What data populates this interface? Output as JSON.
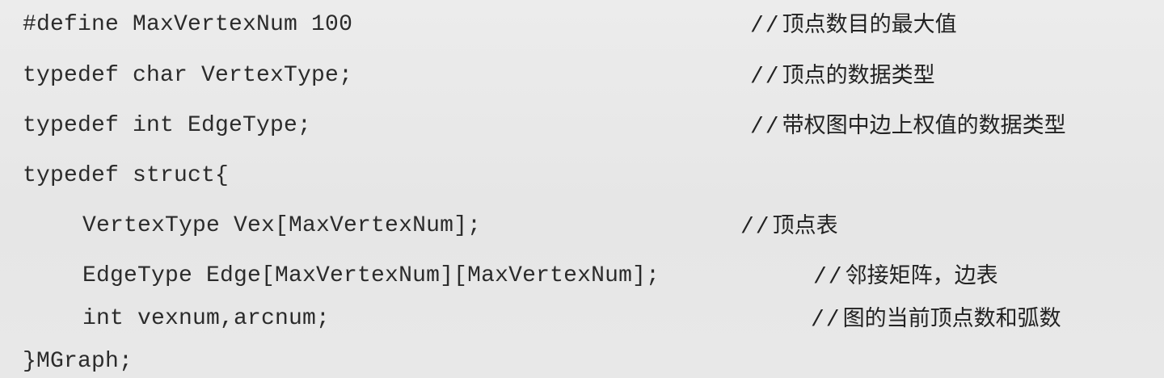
{
  "lines": [
    {
      "code": "#define MaxVertexNum 100",
      "comment_text": "顶点数目的最大值"
    },
    {
      "code": "typedef char VertexType;",
      "comment_text": "顶点的数据类型"
    },
    {
      "code": "typedef int EdgeType;",
      "comment_text": "带权图中边上权值的数据类型"
    },
    {
      "code": "typedef struct{",
      "comment_text": ""
    },
    {
      "code": "VertexType Vex[MaxVertexNum];",
      "comment_text": "顶点表"
    },
    {
      "code": "EdgeType Edge[MaxVertexNum][MaxVertexNum];",
      "comment_text": "邻接矩阵，边表"
    },
    {
      "code": "int vexnum,arcnum;",
      "comment_text": "图的当前顶点数和弧数"
    },
    {
      "code": "}MGraph;",
      "comment_text": ""
    }
  ],
  "comment_prefix": "//",
  "colors": {
    "background": "#e9e9e9",
    "text": "#2b2b2b"
  }
}
